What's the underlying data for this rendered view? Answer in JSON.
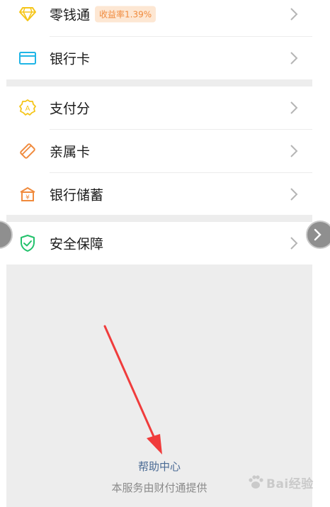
{
  "group1": {
    "items": [
      {
        "label": "零钱通",
        "icon": "diamond-icon",
        "badge": "收益率1.39%"
      },
      {
        "label": "银行卡",
        "icon": "bank-card-icon"
      }
    ]
  },
  "group2": {
    "items": [
      {
        "label": "支付分",
        "icon": "pay-score-icon"
      },
      {
        "label": "亲属卡",
        "icon": "family-card-icon"
      },
      {
        "label": "银行储蓄",
        "icon": "bank-savings-icon"
      }
    ]
  },
  "group3": {
    "items": [
      {
        "label": "安全保障",
        "icon": "shield-check-icon"
      }
    ]
  },
  "footer": {
    "help_link": "帮助中心",
    "provider_text": "本服务由财付通提供"
  },
  "watermark": {
    "text": "Bai经验"
  },
  "colors": {
    "yellow_icon": "#f5c518",
    "cyan_icon": "#1fb5e6",
    "orange_icon": "#f08a3c",
    "green_icon": "#22c16b",
    "link_blue": "#4a6a94",
    "annotation_red": "#f03c3c"
  }
}
